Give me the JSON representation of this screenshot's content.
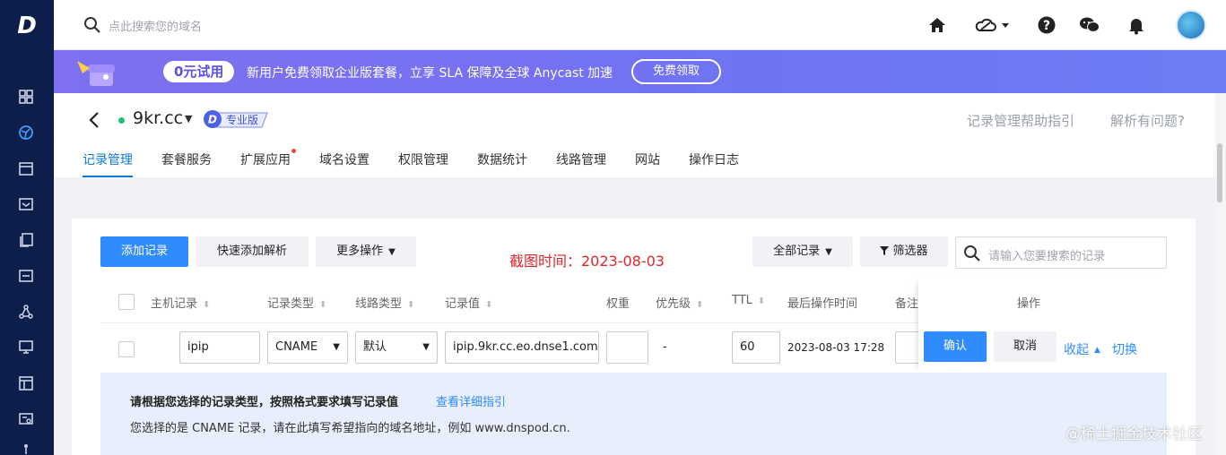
{
  "app": {
    "logo": "D"
  },
  "topbar": {
    "search_placeholder": "点此搜索您的域名"
  },
  "banner": {
    "badge": "0元试用",
    "text": "新用户免费领取企业版套餐，立享 SLA 保障及全球 Anycast 加速",
    "button": "免费领取"
  },
  "domain": {
    "name": "9kr.cc",
    "plan": "专业版",
    "help_links": [
      "记录管理帮助指引",
      "解析有问题?"
    ]
  },
  "tabs": [
    {
      "label": "记录管理",
      "active": true
    },
    {
      "label": "套餐服务"
    },
    {
      "label": "扩展应用",
      "dot": true
    },
    {
      "label": "域名设置"
    },
    {
      "label": "权限管理"
    },
    {
      "label": "数据统计"
    },
    {
      "label": "线路管理"
    },
    {
      "label": "网站"
    },
    {
      "label": "操作日志"
    }
  ],
  "toolbar": {
    "add_record": "添加记录",
    "quick_add": "快速添加解析",
    "more_ops": "更多操作",
    "screenshot_time": "截图时间：2023-08-03",
    "all_records": "全部记录",
    "filter": "筛选器",
    "search_placeholder": "请输入您要搜索的记录"
  },
  "table": {
    "headers": {
      "host": "主机记录",
      "type": "记录类型",
      "line": "线路类型",
      "value": "记录值",
      "weight": "权重",
      "priority": "优先级",
      "ttl": "TTL",
      "last_op": "最后操作时间",
      "remark": "备注",
      "ops": "操作"
    },
    "edit_row": {
      "host": "ipip",
      "type": "CNAME",
      "line": "默认",
      "value": "ipip.9kr.cc.eo.dnse1.com",
      "weight": "",
      "priority": "-",
      "ttl": "60",
      "last_op": "2023-08-03 17:28",
      "confirm": "确认",
      "cancel": "取消",
      "collapse": "收起",
      "switch": "切换"
    }
  },
  "tip": {
    "title": "请根据您选择的记录类型，按照格式要求填写记录值",
    "link": "查看详细指引",
    "desc": "您选择的是 CNAME 记录，请在此填写希望指向的域名地址，例如 www.dnspod.cn."
  },
  "watermark": "@稀土掘金技术社区"
}
